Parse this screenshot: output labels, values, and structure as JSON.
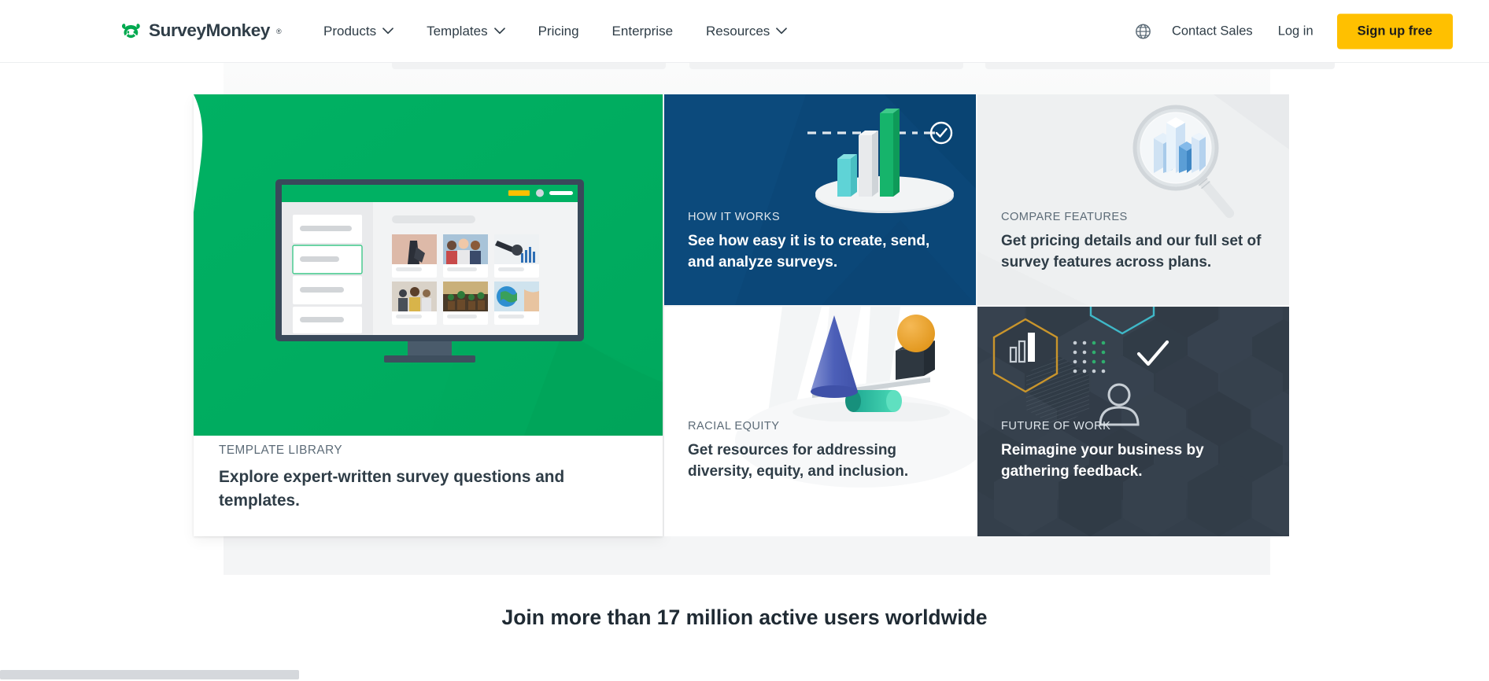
{
  "header": {
    "logo": {
      "text": "SurveyMonkey",
      "registered": "®",
      "icon": "surveymonkey-logo-icon",
      "color": "#00a94f"
    },
    "nav": [
      {
        "label": "Products",
        "has_dropdown": true
      },
      {
        "label": "Templates",
        "has_dropdown": true
      },
      {
        "label": "Pricing",
        "has_dropdown": false
      },
      {
        "label": "Enterprise",
        "has_dropdown": false
      },
      {
        "label": "Resources",
        "has_dropdown": true
      }
    ],
    "globe_icon": "globe-icon",
    "contact_sales": "Contact Sales",
    "log_in": "Log in",
    "sign_up": "Sign up free",
    "sign_up_color": "#ffc000"
  },
  "cards": {
    "template": {
      "eyebrow": "TEMPLATE LIBRARY",
      "headline": "Explore expert-written survey questions and templates.",
      "art": "monitor-template-gallery-illustration",
      "accent_color": "#00b163"
    },
    "how_it_works": {
      "eyebrow": "HOW IT WORKS",
      "headline": "See how easy it is to create, send, and analyze surveys.",
      "art": "bar-chart-target-illustration",
      "bg_color": "#0b4778"
    },
    "compare_features": {
      "eyebrow": "COMPARE FEATURES",
      "headline": "Get pricing details and our full set of survey features across plans.",
      "art": "magnifying-glass-chart-illustration",
      "bg_color": "#eef0f1"
    },
    "racial_equity": {
      "eyebrow": "RACIAL EQUITY",
      "headline": "Get resources for addressing diversity, equity, and inclusion.",
      "art": "balance-shapes-illustration",
      "bg_color": "#ffffff"
    },
    "future_of_work": {
      "eyebrow": "FUTURE OF WORK",
      "headline": "Reimagine your business by gathering feedback.",
      "art": "hexagon-icons-illustration",
      "bg_color": "#343f4b"
    }
  },
  "section": {
    "join_heading": "Join more than 17 million active users worldwide"
  }
}
